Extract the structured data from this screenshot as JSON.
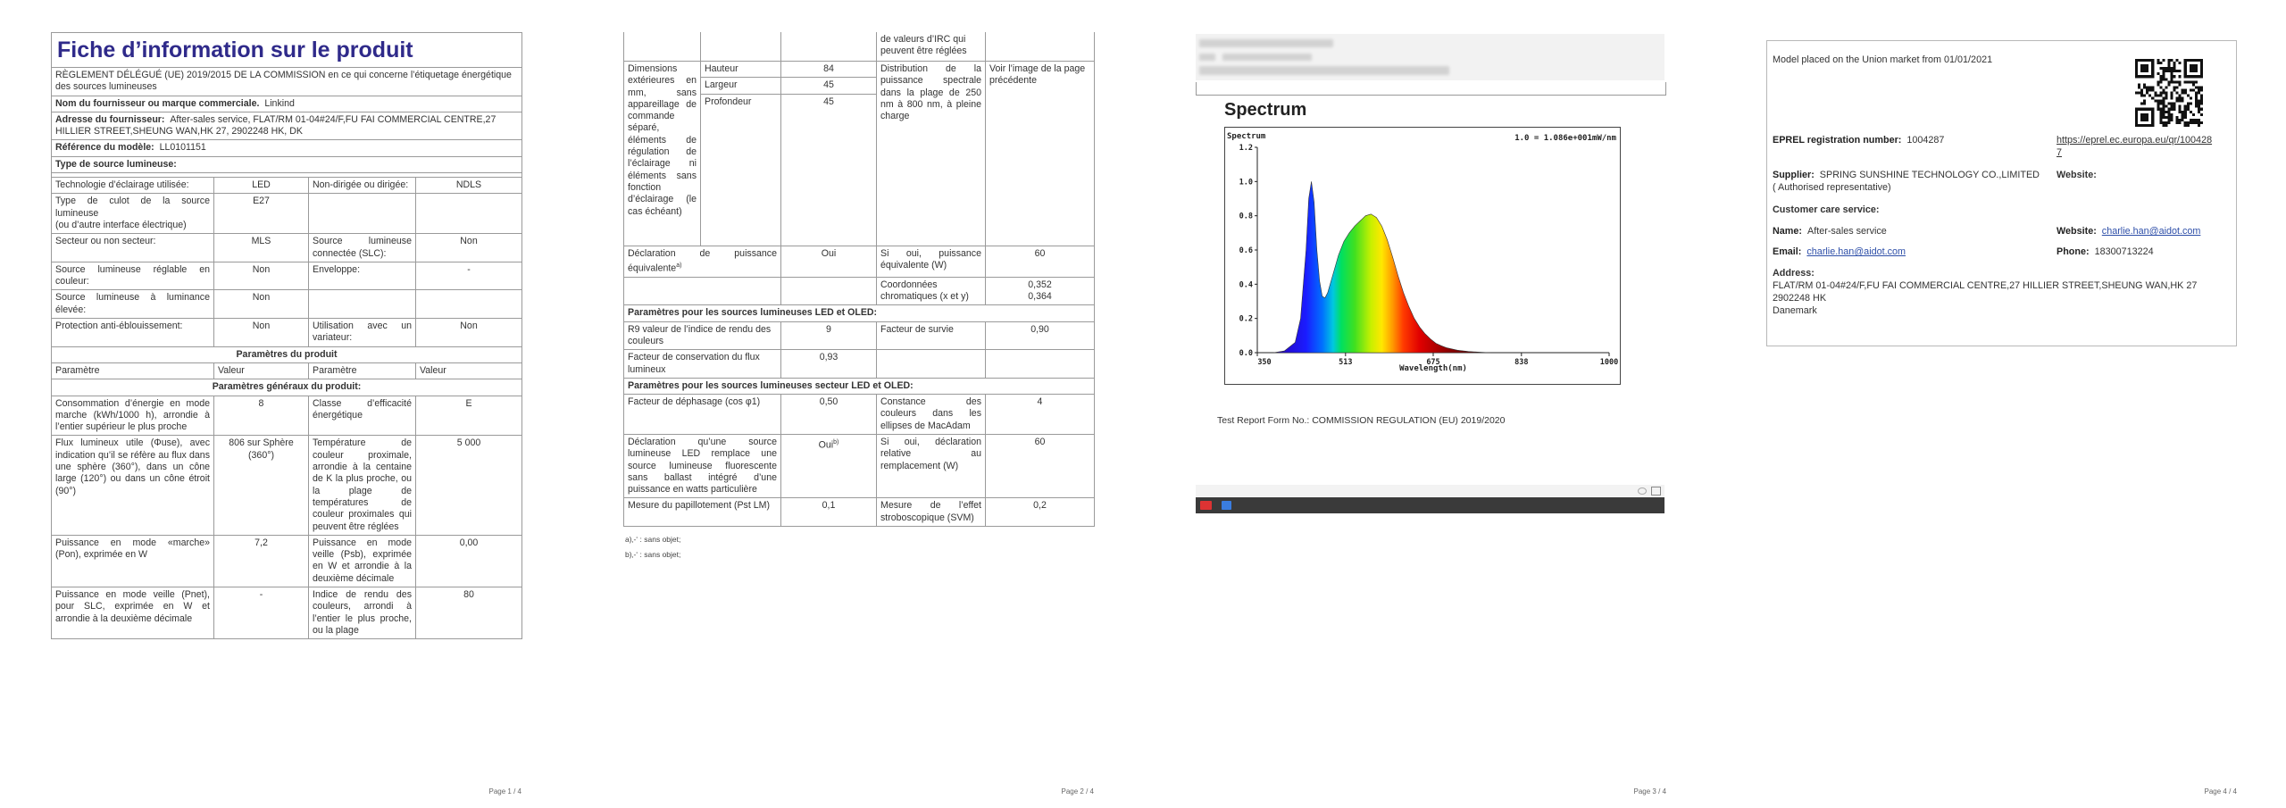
{
  "page1": {
    "title": "Fiche d’information sur le produit",
    "regulation": "RÈGLEMENT DÉLÉGUÉ (UE) 2019/2015 DE LA COMMISSION en ce qui concerne l’étiquetage énergétique des sources lumineuses",
    "supplier_label": "Nom du fournisseur ou marque commerciale.",
    "supplier_value": "Linkind",
    "address_label": "Adresse du fournisseur:",
    "address_value": "After-sales service, FLAT/RM 01-04#24/F,FU FAI COMMERCIAL CENTRE,27 HILLIER STREET,SHEUNG WAN,HK 27, 2902248 HK, DK",
    "model_label": "Référence du modèle:",
    "model_value": "LL0101151",
    "source_type_label": "Type de source lumineuse:",
    "rows_a": [
      [
        "Technologie d’éclairage utilisée:",
        "LED",
        "Non-dirigée ou dirigée:",
        "NDLS"
      ],
      [
        "Type de culot de la source lumineuse\n(ou d’autre interface électrique)",
        "E27",
        "",
        ""
      ],
      [
        "Secteur ou non secteur:",
        "MLS",
        "Source lumineuse connectée (SLC):",
        "Non"
      ],
      [
        "Source lumineuse réglable en couleur:",
        "Non",
        "Enveloppe:",
        "-"
      ],
      [
        "Source lumineuse à luminance élevée:",
        "Non",
        "",
        ""
      ],
      [
        "Protection anti-éblouissement:",
        "Non",
        "Utilisation avec un variateur:",
        "Non"
      ]
    ],
    "product_params": "Paramètres du produit",
    "col_headers": [
      "Paramètre",
      "Valeur",
      "Paramètre",
      "Valeur"
    ],
    "general_params": "Paramètres généraux du produit:",
    "rows_b": [
      [
        "Consommation d’énergie en mode marche (kWh/1000 h), arrondie à l’entier supérieur le plus proche",
        "8",
        "Classe d’efficacité énergétique",
        "E"
      ],
      [
        "Flux lumineux utile (Φuse), avec indication qu’il se réfère au flux dans une sphère (360°), dans un cône large (120°) ou dans un cône étroit (90°)",
        "806 sur Sphère (360°)",
        "Température de couleur proximale, arrondie à la centaine de K la plus proche, ou la plage de températures de couleur proximales qui peuvent être réglées",
        "5 000"
      ],
      [
        "Puissance en mode «marche» (Pon), exprimée en W",
        "7,2",
        "Puissance en mode veille (Psb), exprimée en W et arrondie à la deuxième décimale",
        "0,00"
      ],
      [
        "Puissance en mode veille (Pnet), pour SLC, exprimée en W et arrondie à la deuxième décimale",
        "-",
        "Indice de rendu des couleurs, arrondi à l’entier le plus proche, ou la plage",
        "80"
      ]
    ],
    "page_num": "Page 1 / 4"
  },
  "page2": {
    "cont_text": "de valeurs d’IRC qui peuvent être réglées",
    "dims_label": "Dimensions extérieures en mm, sans appareillage de commande séparé, éléments de régulation de l’éclairage ni éléments sans fonction d’éclairage (le cas échéant)",
    "dims": [
      [
        "Hauteur",
        "84"
      ],
      [
        "Largeur",
        "45"
      ],
      [
        "Profondeur",
        "45"
      ]
    ],
    "spectral_label": "Distribution de la puissance spectrale dans la plage de 250 nm à 800 nm, à pleine charge",
    "spectral_value": "Voir l’image de la page précédente",
    "equiv_label": "Déclaration de puissance équivalente",
    "equiv_sup": "a)",
    "equiv_value": "Oui",
    "equiv_power_label": "Si oui, puissance équivalente (W)",
    "equiv_power_value": "60",
    "chroma_label": "Coordonnées chromatiques (x et y)",
    "chroma_value_x": "0,352",
    "chroma_value_y": "0,364",
    "led_oled": "Paramètres pour les sources lumineuses LED et OLED:",
    "r9_label": "R9 valeur de l’indice de rendu des couleurs",
    "r9_value": "9",
    "survival_label": "Facteur de survie",
    "survival_value": "0,90",
    "flux_maint_label": "Facteur de conservation du flux lumineux",
    "flux_maint_value": "0,93",
    "mains": "Paramètres pour les sources lumineuses secteur LED et OLED:",
    "phase_label": "Facteur de déphasage (cos φ1)",
    "phase_value": "0,50",
    "macadam_label": "Constance des couleurs dans les ellipses de MacAdam",
    "macadam_value": "4",
    "replace_label": "Déclaration qu’une source lumineuse LED remplace une source lumineuse fluorescente sans ballast intégré d’une puissance en watts particulière",
    "replace_value": "Oui",
    "replace_sup": "b)",
    "replace_power_label": "Si oui, déclaration relative au remplacement (W)",
    "replace_power_value": "60",
    "pst_label": "Mesure du papillotement (Pst LM)",
    "pst_value": "0,1",
    "svm_label": "Mesure de l’effet stroboscopique (SVM)",
    "svm_value": "0,2",
    "foot_a": "a)‚-‘ : sans objet;",
    "foot_b": "b)‚-‘ : sans objet;",
    "page_num": "Page 2 / 4"
  },
  "page3": {
    "spectrum_title": "Spectrum",
    "chart_title": "Spectrum",
    "chart_note": "1.0 = 1.086e+001mW/nm",
    "caption": "Test Report Form No.: COMMISSION REGULATION (EU) 2019/2020",
    "page_num": "Page 3 / 4"
  },
  "page4": {
    "placed": "Model placed on the Union market from 01/01/2021",
    "eprel_label": "EPREL registration number:",
    "eprel_value": "1004287",
    "eprel_link": "https://eprel.ec.europa.eu/qr/1004287",
    "supplier_label": "Supplier:",
    "supplier_value": "SPRING SUNSHINE TECHNOLOGY CO.,LIMITED ( Authorised representative)",
    "website_label": "Website:",
    "care_label": "Customer care service:",
    "name_label": "Name:",
    "name_value": "After-sales service",
    "website2_label": "Website:",
    "website2_value": "charlie.han@aidot.com",
    "email_label": "Email:",
    "email_value": "charlie.han@aidot.com",
    "phone_label": "Phone:",
    "phone_value": "18300713224",
    "address_label": "Address:",
    "address_value": "FLAT/RM 01-04#24/F,FU FAI COMMERCIAL CENTRE,27 HILLIER STREET,SHEUNG WAN,HK 27 2902248 HK",
    "country": "Danemark",
    "page_num": "Page 4 / 4"
  },
  "chart_data": {
    "type": "area",
    "title": "Spectrum",
    "xlabel": "Wavelength(nm)",
    "ylabel": "",
    "note": "1.0 = 1.086e+001mW/nm",
    "xlim": [
      350,
      1000
    ],
    "ylim": [
      0,
      1.2
    ],
    "x_ticks": [
      "350",
      "513",
      "675",
      "838",
      "1000"
    ],
    "y_ticks": [
      "0.0",
      "0.2",
      "0.4",
      "0.6",
      "0.8",
      "1.0",
      "1.2"
    ],
    "x": [
      380,
      400,
      420,
      430,
      440,
      445,
      450,
      455,
      460,
      465,
      470,
      475,
      480,
      490,
      500,
      510,
      520,
      530,
      540,
      550,
      560,
      570,
      580,
      590,
      600,
      610,
      620,
      630,
      640,
      650,
      660,
      670,
      680,
      690,
      700,
      720,
      740,
      760,
      780
    ],
    "y": [
      0.0,
      0.01,
      0.06,
      0.2,
      0.6,
      0.9,
      1.0,
      0.88,
      0.6,
      0.42,
      0.33,
      0.32,
      0.35,
      0.46,
      0.57,
      0.65,
      0.7,
      0.74,
      0.77,
      0.8,
      0.81,
      0.79,
      0.74,
      0.66,
      0.56,
      0.45,
      0.35,
      0.27,
      0.2,
      0.15,
      0.11,
      0.08,
      0.055,
      0.04,
      0.028,
      0.014,
      0.007,
      0.003,
      0.0
    ],
    "grid": false,
    "legend": "none"
  }
}
